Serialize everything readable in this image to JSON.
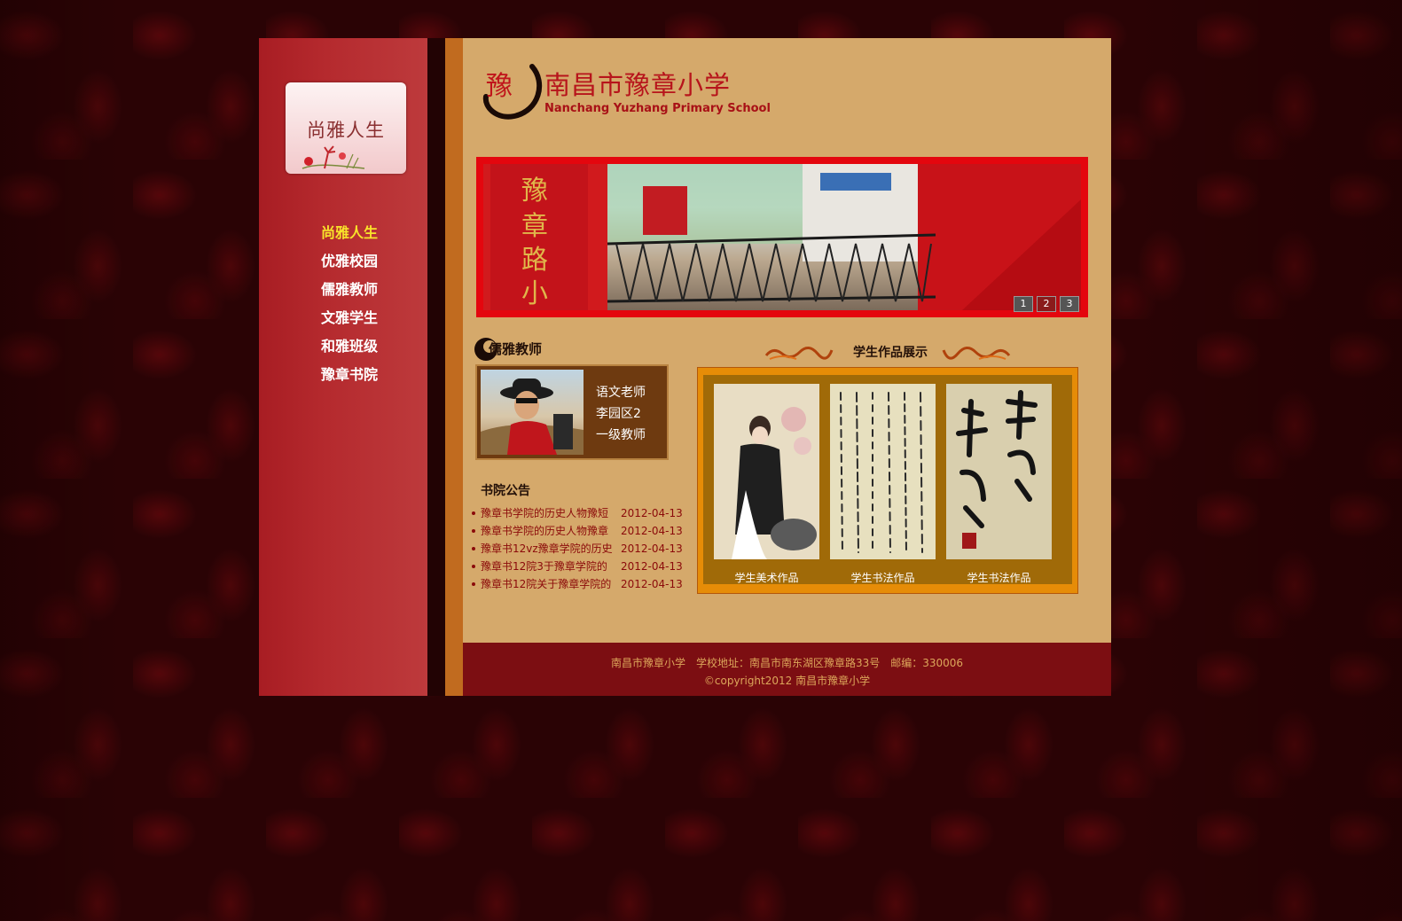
{
  "logo_card": {
    "label": "尚雅人生"
  },
  "nav": [
    "尚雅人生",
    "优雅校园",
    "儒雅教师",
    "文雅学生",
    "和雅班级",
    "豫章书院"
  ],
  "header": {
    "name_cn": "南昌市豫章小学",
    "name_en": "Nanchang Yuzhang Primary School"
  },
  "banner": {
    "pages": [
      "1",
      "2",
      "3"
    ],
    "current": "2"
  },
  "teacher": {
    "title": "儒雅教师",
    "lines": [
      "语文老师",
      "李园区2",
      "一级教师"
    ]
  },
  "notices": {
    "title": "书院公告",
    "items": [
      {
        "text": "豫章书学院的历史人物豫短",
        "date": "2012-04-13"
      },
      {
        "text": "豫章书学院的历史人物豫章",
        "date": "2012-04-13"
      },
      {
        "text": "豫章书12vz豫章学院的历史",
        "date": "2012-04-13"
      },
      {
        "text": "豫章书12院3于豫章学院的",
        "date": "2012-04-13"
      },
      {
        "text": "豫章书12院关于豫章学院的",
        "date": "2012-04-13"
      }
    ]
  },
  "works": {
    "title": "学生作品展示",
    "items": [
      {
        "caption": "学生美术作品"
      },
      {
        "caption": "学生书法作品"
      },
      {
        "caption": "学生书法作品"
      }
    ]
  },
  "footer": {
    "line1": "南昌市豫章小学　学校地址：南昌市南东湖区豫章路33号　邮编：330006",
    "line2": "©copyright2012 南昌市豫章小学"
  }
}
